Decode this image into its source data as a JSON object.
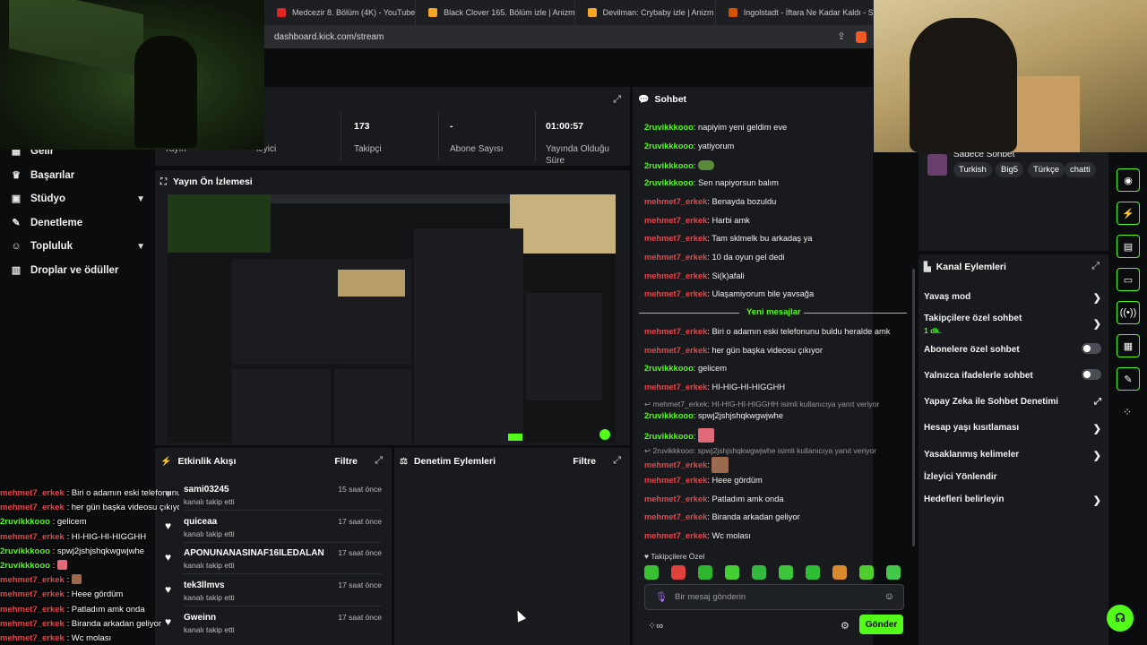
{
  "browser": {
    "tabs": [
      {
        "title": "Medcezir 8. Bölüm (4K) - YouTube",
        "color": "#e02424"
      },
      {
        "title": "Black Clover 165. Bölüm izle | Anizm",
        "color": "#f5a623"
      },
      {
        "title": "Devilman: Crybaby izle | Anizm",
        "color": "#f5a623"
      },
      {
        "title": "Ingolstadt - İftara Ne Kadar Kaldı - S",
        "color": "#d35400"
      }
    ],
    "url": "dashboard.kick.com/stream"
  },
  "sidebar": {
    "items": [
      {
        "label": "Gelir",
        "icon": "money-icon"
      },
      {
        "label": "Başarılar",
        "icon": "trophy-icon"
      },
      {
        "label": "Stüdyo",
        "icon": "studio-icon",
        "expandable": true
      },
      {
        "label": "Denetleme",
        "icon": "wrench-icon"
      },
      {
        "label": "Topluluk",
        "icon": "community-icon",
        "expandable": true
      },
      {
        "label": "Droplar ve ödüller",
        "icon": "gift-icon"
      }
    ]
  },
  "stats": {
    "partial_left": "Yayın",
    "partial_viewers": "leyici",
    "followers_value": "173",
    "followers_label": "Takipçi",
    "subs_value": "-",
    "subs_label": "Abone Sayısı",
    "uptime_value": "01:00:57",
    "uptime_label": "Yayında Olduğu Süre"
  },
  "preview": {
    "title": "Yayın Ön İzlemesi"
  },
  "events": {
    "title": "Etkinlik Akışı",
    "filter_label": "Filtre",
    "items": [
      {
        "name": "sami03245",
        "action": "kanalı takip etti",
        "time": "15 saat önce"
      },
      {
        "name": "quiceaa",
        "action": "kanalı takip etti",
        "time": "17 saat önce"
      },
      {
        "name": "APONUNANASINAF16ILEDALAN",
        "action": "kanalı takip etti",
        "time": "17 saat önce"
      },
      {
        "name": "tek3llmvs",
        "action": "kanalı takip etti",
        "time": "17 saat önce"
      },
      {
        "name": "Gweinn",
        "action": "kanalı takip etti",
        "time": "17 saat önce"
      }
    ]
  },
  "moderation": {
    "title": "Denetim Eylemleri",
    "filter_label": "Filtre"
  },
  "chat": {
    "title": "Sohbet",
    "messages": [
      {
        "user": "2ruvikkkooo",
        "color": "green",
        "text": "napiyim yeni geldim eve"
      },
      {
        "user": "2ruvikkkooo",
        "color": "green",
        "text": "yatiyorum"
      },
      {
        "user": "2ruvikkkooo",
        "color": "green",
        "text": "",
        "emote": true
      },
      {
        "user": "2ruvikkkooo",
        "color": "green",
        "text": "Sen napiyorsun balım"
      },
      {
        "user": "mehmet7_erkek",
        "color": "red",
        "text": "Benayda bozuldu"
      },
      {
        "user": "mehmet7_erkek",
        "color": "red",
        "text": "Harbi amk"
      },
      {
        "user": "mehmet7_erkek",
        "color": "red",
        "text": "Tam sklmelk bu arkadaş ya"
      },
      {
        "user": "mehmet7_erkek",
        "color": "red",
        "text": "10 da oyun gel dedi"
      },
      {
        "user": "mehmet7_erkek",
        "color": "red",
        "text": "Si(k)afali"
      },
      {
        "user": "mehmet7_erkek",
        "color": "red",
        "text": "Ulaşamiyorum bile yavsağa"
      }
    ],
    "new_messages_label": "Yeni mesajlar",
    "messages_after": [
      {
        "user": "mehmet7_erkek",
        "color": "red",
        "text": "Biri o adamın eski telefonunu buldu heralde amk"
      },
      {
        "user": "mehmet7_erkek",
        "color": "red",
        "text": "her gün başka videosu çıkıyor"
      },
      {
        "user": "2ruvikkkooo",
        "color": "green",
        "text": "gelicem"
      },
      {
        "user": "mehmet7_erkek",
        "color": "red",
        "text": "HI-HIG-HI-HIGGHH"
      }
    ],
    "reply1": "mehmet7_erkek: HI-HIG-HI-HIGGHH isimli kullanıcıya yanıt veriyor",
    "reply1_user": "2ruvikkkooo",
    "reply1_text": "spwj2jshjshqkwgwjwhe",
    "emote_msg_user": "2ruvikkkooo",
    "reply2": "2ruvikkkooo: spwj2jshjshqkwgwjwhe isimli kullanıcıya yanıt veriyor",
    "reply2_user": "mehmet7_erkek",
    "messages_tail": [
      {
        "user": "mehmet7_erkek",
        "color": "red",
        "text": "Heee gördüm"
      },
      {
        "user": "mehmet7_erkek",
        "color": "red",
        "text": "Patladım amk onda"
      },
      {
        "user": "mehmet7_erkek",
        "color": "red",
        "text": "Biranda arkadan geliyor"
      },
      {
        "user": "mehmet7_erkek",
        "color": "red",
        "text": "Wc molası"
      }
    ],
    "follower_only_label": "Takipçilere Özel",
    "input_placeholder": "Bir mesaj gönderin",
    "send_label": "Gönder"
  },
  "overlay_chat": [
    {
      "user": "mehmet7_erkek",
      "color": "red",
      "text": "Biri o adamın eski telefonunu buldu heralde amk"
    },
    {
      "user": "mehmet7_erkek",
      "color": "red",
      "text": "her gün başka videosu çıkıyor"
    },
    {
      "user": "2ruvikkkooo",
      "color": "green",
      "text": "gelicem"
    },
    {
      "user": "mehmet7_erkek",
      "color": "red",
      "text": "HI-HIG-HI-HIGGHH"
    },
    {
      "user": "2ruvikkkooo",
      "color": "green",
      "text": "spwj2jshjshqkwgwjwhe"
    },
    {
      "user": "2ruvikkkooo",
      "color": "green",
      "text": "",
      "emote": "#e06a7a"
    },
    {
      "user": "mehmet7_erkek",
      "color": "red",
      "text": "",
      "emote": "#9c6b4f"
    },
    {
      "user": "mehmet7_erkek",
      "color": "red",
      "text": "Heee gördüm"
    },
    {
      "user": "mehmet7_erkek",
      "color": "red",
      "text": "Patladım amk onda"
    },
    {
      "user": "mehmet7_erkek",
      "color": "red",
      "text": "Biranda arkadan geliyor"
    },
    {
      "user": "mehmet7_erkek",
      "color": "red",
      "text": "Wc molası"
    }
  ],
  "info_card": {
    "title": "Sadece Sohbet",
    "tags": [
      "Turkish",
      "Big5",
      "Türkçe",
      "chatti"
    ]
  },
  "actions": {
    "title": "Kanal Eylemleri",
    "items": [
      {
        "label": "Yavaş mod",
        "control": "chevron"
      },
      {
        "label": "Takipçilere özel sohbet",
        "sub": "1 dk.",
        "control": "chevron"
      },
      {
        "label": "Abonelere özel sohbet",
        "control": "toggle"
      },
      {
        "label": "Yalnızca ifadelerle sohbet",
        "control": "toggle"
      },
      {
        "label": "Yapay Zeka ile Sohbet Denetimi",
        "control": "external"
      },
      {
        "label": "Hesap yaşı kısıtlaması",
        "control": "chevron"
      },
      {
        "label": "Yasaklanmış kelimeler",
        "control": "chevron"
      },
      {
        "label": "İzleyici Yönlendir",
        "control": "none"
      },
      {
        "label": "Hedefleri belirleyin",
        "control": "chevron"
      }
    ]
  },
  "colors": {
    "accent": "#53fc18",
    "user_red": "#e5484d",
    "panel": "#181a1d"
  }
}
